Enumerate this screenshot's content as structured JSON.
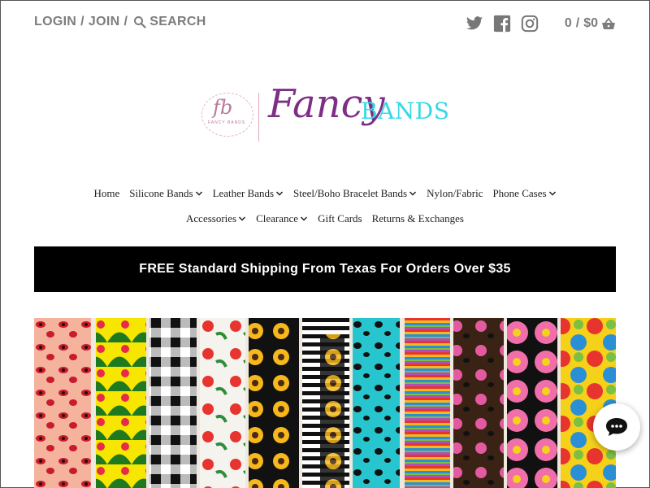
{
  "header": {
    "login_label": "LOGIN",
    "separator": "/",
    "join_label": "JOIN",
    "search_label": "SEARCH",
    "cart_count": "0",
    "cart_total": "$0",
    "social_icons": [
      "twitter-icon",
      "facebook-icon",
      "instagram-icon"
    ]
  },
  "logo": {
    "monogram": "fb",
    "monogram_caption": "FANCY BANDS",
    "script_word": "Fancy",
    "block_word": "BANDS",
    "colors": {
      "script": "#7d2f86",
      "block": "#34d9e8",
      "monogram": "#b8789a"
    }
  },
  "nav": {
    "row1": [
      {
        "label": "Home",
        "dropdown": false
      },
      {
        "label": "Silicone Bands",
        "dropdown": true
      },
      {
        "label": "Leather Bands",
        "dropdown": true
      },
      {
        "label": "Steel/Boho Bracelet Bands",
        "dropdown": true
      },
      {
        "label": "Nylon/Fabric",
        "dropdown": false
      },
      {
        "label": "Phone Cases",
        "dropdown": true
      }
    ],
    "row2": [
      {
        "label": "Accessories",
        "dropdown": true
      },
      {
        "label": "Clearance",
        "dropdown": true
      },
      {
        "label": "Gift Cards",
        "dropdown": false
      },
      {
        "label": "Returns & Exchanges",
        "dropdown": false
      }
    ]
  },
  "banner": {
    "text": "FREE Standard Shipping From Texas For Orders Over $35",
    "background": "#000000",
    "color": "#ffffff"
  },
  "hero": {
    "image_icon": "watch-bands-photo"
  },
  "chat": {
    "icon": "chat-bubble-icon"
  }
}
